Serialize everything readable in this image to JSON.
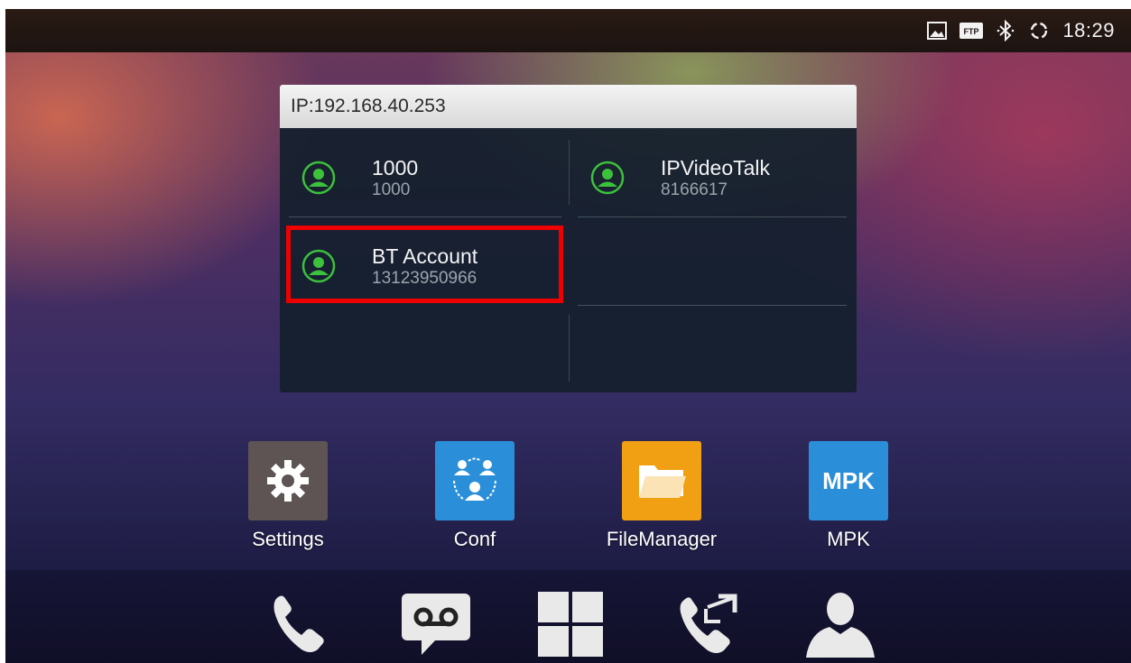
{
  "status_bar": {
    "icons": [
      "image-icon",
      "ftp-icon",
      "bluetooth-icon",
      "sync-icon"
    ],
    "ftp_text": "FTP",
    "time": "18:29"
  },
  "widget": {
    "header": "IP:192.168.40.253",
    "accounts": [
      {
        "name": "1000",
        "number": "1000",
        "icon": "account-icon"
      },
      {
        "name": "IPVideoTalk",
        "number": "8166617",
        "icon": "account-icon"
      },
      {
        "name": "BT Account",
        "number": "13123950966",
        "icon": "account-icon",
        "highlighted": true
      }
    ],
    "highlight_color": "#ee0000"
  },
  "apps": [
    {
      "label": "Settings",
      "icon": "gear-icon",
      "color": "#5d5453"
    },
    {
      "label": "Conf",
      "icon": "conference-icon",
      "color": "#2a8fd8"
    },
    {
      "label": "FileManager",
      "icon": "folder-icon",
      "color": "#f0a012"
    },
    {
      "label": "MPK",
      "icon": "mpk-icon",
      "icon_text": "MPK",
      "color": "#2a8fd8"
    }
  ],
  "dock": [
    {
      "icon": "phone-icon"
    },
    {
      "icon": "voicemail-icon"
    },
    {
      "icon": "apps-grid-icon"
    },
    {
      "icon": "call-transfer-icon"
    },
    {
      "icon": "contacts-icon"
    }
  ],
  "colors": {
    "account_green": "#3cc13c",
    "status_bar": "#1c1411"
  }
}
